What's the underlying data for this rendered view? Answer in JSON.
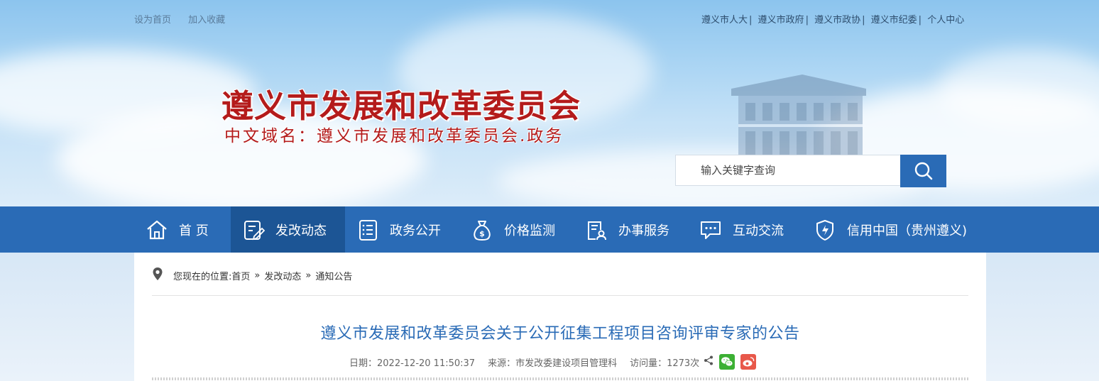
{
  "top_links_left": [
    "设为首页",
    "加入收藏"
  ],
  "top_links_right": [
    "遵义市人大",
    "遵义市政府",
    "遵义市政协",
    "遵义市纪委",
    "个人中心"
  ],
  "top_links_sep": "|",
  "site": {
    "title": "遵义市发展和改革委员会",
    "domain": "中文域名：遵义市发展和改革委员会.政务"
  },
  "search": {
    "placeholder": "输入关键字查询",
    "icon": "search-icon"
  },
  "nav": {
    "items": [
      {
        "label": "首 页",
        "icon": "home-icon"
      },
      {
        "label": "发改动态",
        "icon": "edit-document-icon",
        "active": true
      },
      {
        "label": "政务公开",
        "icon": "list-document-icon"
      },
      {
        "label": "价格监测",
        "icon": "money-bag-icon"
      },
      {
        "label": "办事服务",
        "icon": "person-document-icon"
      },
      {
        "label": "互动交流",
        "icon": "chat-bubble-icon"
      },
      {
        "label": "信用中国（贵州遵义)",
        "icon": "shield-icon"
      }
    ]
  },
  "breadcrumb": {
    "prefix": "您现在的位置:",
    "items": [
      "首页",
      "发改动态",
      "通知公告"
    ],
    "arrow": "»"
  },
  "article": {
    "title": "遵义市发展和改革委员会关于公开征集工程项目咨询评审专家的公告",
    "date": "日期：2022-12-20 11:50:37",
    "source": "来源：市发改委建设项目管理科",
    "views": "访问量：1273次"
  },
  "colors": {
    "brand_blue": "#2a6bb6",
    "title_red": "#b41b1b",
    "wechat_green": "#3cb034",
    "weibo_red": "#e8584a"
  }
}
